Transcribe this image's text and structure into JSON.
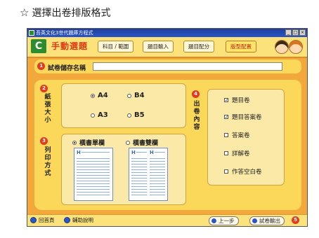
{
  "heading": {
    "star_icon": "☆",
    "text": "選擇出卷排版格式"
  },
  "window": {
    "title": "吾英文化3世代題庫方程式",
    "controls": [
      "_",
      "□",
      "×"
    ]
  },
  "toolbar": {
    "logo": "C",
    "app_title": "手動選題",
    "tabs": [
      {
        "label": "科目 / 範圍",
        "active": false
      },
      {
        "label": "題目輸入",
        "active": false
      },
      {
        "label": "題目配分",
        "active": false
      },
      {
        "label": "版型配置",
        "active": true
      }
    ]
  },
  "section1": {
    "number": "1",
    "label": "試卷儲存名稱",
    "input_value": ""
  },
  "paper_size": {
    "number": "2",
    "label": "紙張大小",
    "options": [
      {
        "label": "A4",
        "selected": true
      },
      {
        "label": "B4",
        "selected": false
      },
      {
        "label": "A3",
        "selected": false
      },
      {
        "label": "B5",
        "selected": false
      }
    ]
  },
  "print_mode": {
    "number": "3",
    "label": "列印方式",
    "options": [
      {
        "label": "橫書單欄",
        "selected": true
      },
      {
        "label": "橫書雙欄",
        "selected": false
      }
    ]
  },
  "content": {
    "number": "4",
    "label": "出卷內容",
    "items": [
      {
        "label": "題目卷",
        "checked": true
      },
      {
        "label": "題目答案卷",
        "checked": true
      },
      {
        "label": "答案卷",
        "checked": false
      },
      {
        "label": "詳解卷",
        "checked": false
      },
      {
        "label": "作答空白卷",
        "checked": false
      }
    ]
  },
  "statusbar": {
    "home_label": "回首頁",
    "help_label": "輔助說明",
    "prev_label": "上一步",
    "export_label": "試卷輸出",
    "export_number": "5"
  },
  "colors": {
    "accent": "#e23b1f",
    "panel": "#fbd75a",
    "window_bg": "#f2a83b",
    "titlebar": "#2b56c8"
  }
}
